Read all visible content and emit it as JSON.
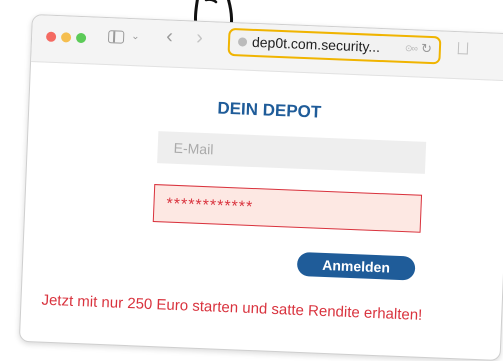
{
  "browser": {
    "url": "dep0t.com.security...",
    "reload_symbol": "↻",
    "ext_symbol": "⊙∞",
    "nav_back": "‹",
    "nav_forward": "›",
    "sidebar_chevron": "⌄"
  },
  "page": {
    "heading": "DEIN DEPOT",
    "email_placeholder": "E-Mail",
    "password_value": "************",
    "login_label": "Anmelden",
    "promo_text": "Jetzt mit nur 250 Euro starten und satte Rendite erhalten!"
  },
  "colors": {
    "heading_blue": "#1f5c99",
    "alert_red": "#d9333e",
    "address_highlight": "#f0b400",
    "password_bg": "#fde8e3"
  },
  "icons": [
    "sidebar-toggle-icon",
    "back-arrow-icon",
    "forward-arrow-icon",
    "lock-globe-icon",
    "reload-icon",
    "share-icon"
  ]
}
